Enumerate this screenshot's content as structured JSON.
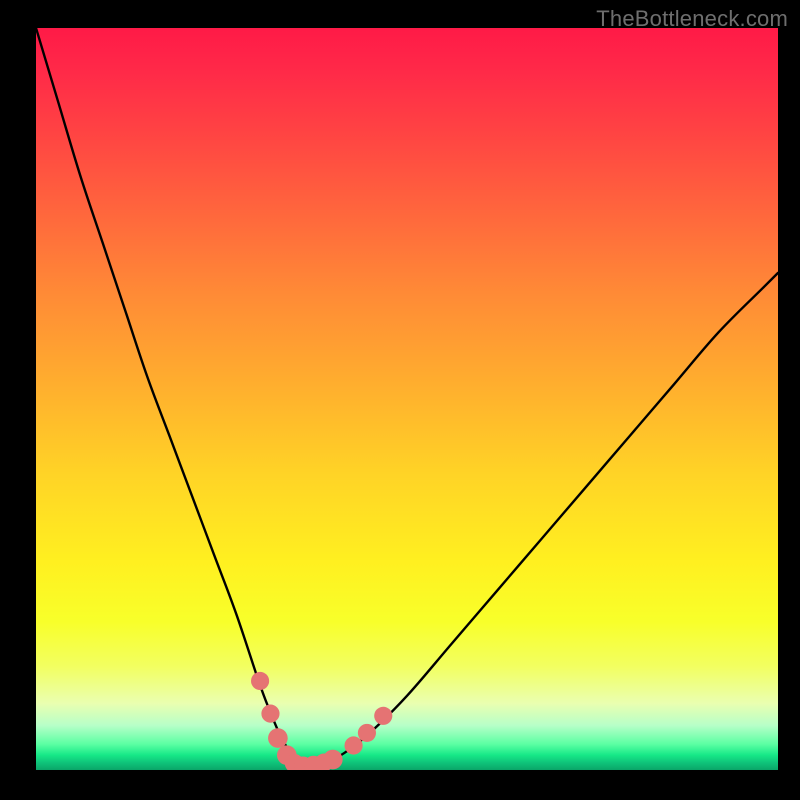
{
  "watermark": "TheBottleneck.com",
  "colors": {
    "frame": "#000000",
    "curve": "#000000",
    "dot_fill": "#e57373",
    "dot_stroke": "#b44a4a"
  },
  "chart_data": {
    "type": "line",
    "title": "",
    "xlabel": "",
    "ylabel": "",
    "xlim": [
      0,
      100
    ],
    "ylim": [
      0,
      100
    ],
    "grid": false,
    "series": [
      {
        "name": "bottleneck-curve",
        "x": [
          0,
          3,
          6,
          9,
          12,
          15,
          18,
          21,
          24,
          27,
          30,
          31.5,
          33,
          34.5,
          35.5,
          36.5,
          38,
          40,
          42,
          45,
          50,
          56,
          62,
          68,
          74,
          80,
          86,
          92,
          98,
          100
        ],
        "y": [
          100,
          90,
          80,
          71,
          62,
          53,
          45,
          37,
          29,
          21,
          12,
          8,
          4.5,
          2,
          0.8,
          0.5,
          0.7,
          1.4,
          2.6,
          5,
          10,
          17,
          24,
          31,
          38,
          45,
          52,
          59,
          65,
          67
        ]
      }
    ],
    "markers": [
      {
        "x": 30.2,
        "y": 12.0,
        "r": 1.1
      },
      {
        "x": 31.6,
        "y": 7.6,
        "r": 1.1
      },
      {
        "x": 32.6,
        "y": 4.3,
        "r": 1.3
      },
      {
        "x": 33.8,
        "y": 2.0,
        "r": 1.3
      },
      {
        "x": 34.8,
        "y": 0.9,
        "r": 1.2
      },
      {
        "x": 36.0,
        "y": 0.6,
        "r": 1.1
      },
      {
        "x": 37.4,
        "y": 0.7,
        "r": 1.1
      },
      {
        "x": 38.8,
        "y": 1.0,
        "r": 1.1
      },
      {
        "x": 40.0,
        "y": 1.4,
        "r": 1.3
      },
      {
        "x": 42.8,
        "y": 3.3,
        "r": 1.1
      },
      {
        "x": 44.6,
        "y": 5.0,
        "r": 1.1
      },
      {
        "x": 46.8,
        "y": 7.3,
        "r": 1.1
      }
    ]
  }
}
